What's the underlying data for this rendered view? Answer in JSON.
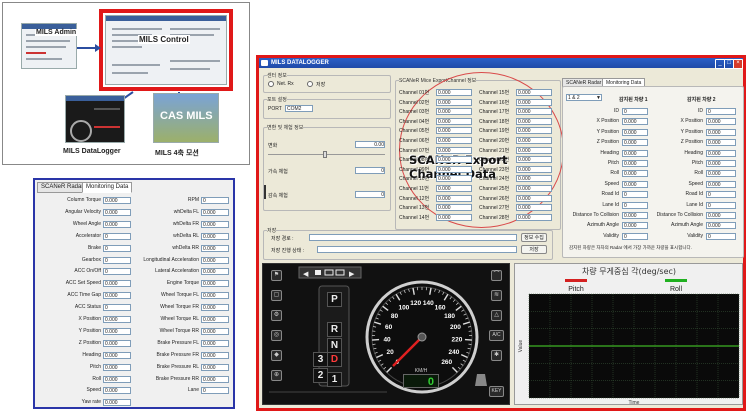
{
  "overview": {
    "admin_label": "MILS Admin",
    "control_label": "MILS  Control",
    "datalogger_label": "MILS DataLogger",
    "sim_label": "MILS 4축 모션",
    "sim_banner": "CAS MILS"
  },
  "radar_panel": {
    "tabs": [
      "SCANeR Radar",
      "Monitoring Data"
    ],
    "left_fields": [
      {
        "label": "Column Torque",
        "value": "0.000"
      },
      {
        "label": "Angular Velocity",
        "value": "0.000"
      },
      {
        "label": "Wheel Angle",
        "value": "0.000"
      },
      {
        "label": "Accelerator",
        "value": "0"
      },
      {
        "label": "Brake",
        "value": "0"
      },
      {
        "label": "Gearbox",
        "value": "0"
      },
      {
        "label": "ACC On/Off",
        "value": "0"
      },
      {
        "label": "ACC Set Speed",
        "value": "0.000"
      },
      {
        "label": "ACC Time Gap",
        "value": "0.000"
      },
      {
        "label": "ACC Status",
        "value": "0"
      },
      {
        "label": "X Position",
        "value": "0.000"
      },
      {
        "label": "Y Position",
        "value": "0.000"
      },
      {
        "label": "Z Position",
        "value": "0.000"
      },
      {
        "label": "Heading",
        "value": "0.000"
      },
      {
        "label": "Pitch",
        "value": "0.000"
      },
      {
        "label": "Roll",
        "value": "0.000"
      },
      {
        "label": "Speed",
        "value": "0.000"
      },
      {
        "label": "Yaw rate",
        "value": "0.000"
      }
    ],
    "right_fields": [
      {
        "label": "RPM",
        "value": "0"
      },
      {
        "label": "whDelta FL",
        "value": "0.000"
      },
      {
        "label": "whDelta FR",
        "value": "0.000"
      },
      {
        "label": "whDelta RL",
        "value": "0.000"
      },
      {
        "label": "whDelta RR",
        "value": "0.000"
      },
      {
        "label": "Longitudinal Acceleration",
        "value": "0.000"
      },
      {
        "label": "Lateral Acceleration",
        "value": "0.000"
      },
      {
        "label": "Engine Torque",
        "value": "0.000"
      },
      {
        "label": "Wheel Torque FL",
        "value": "0.000"
      },
      {
        "label": "Wheel Torque FR",
        "value": "0.000"
      },
      {
        "label": "Wheel Torque RL",
        "value": "0.000"
      },
      {
        "label": "Wheel Torque RR",
        "value": "0.000"
      },
      {
        "label": "Brake Pressure FL",
        "value": "0.000"
      },
      {
        "label": "Brake Pressure FR",
        "value": "0.000"
      },
      {
        "label": "Brake Pressure RL",
        "value": "0.000"
      },
      {
        "label": "Brake Pressure RR",
        "value": "0.000"
      },
      {
        "label": "Lane",
        "value": "0"
      }
    ]
  },
  "window": {
    "title": "MILS DATALOGGER",
    "conn_group": "센터 정보",
    "net_rx": "Net. Rx",
    "save_chk": "저장",
    "port_group": "포트 설정",
    "port_label": "PORT",
    "port_value": "COM2",
    "slider_group": "변환 및 체험 정보",
    "slider1_label": "변화",
    "slider1_value": "0.00",
    "slider2_label": "가속 체험",
    "slider2_value": "0",
    "slider3_label": "감속 체험",
    "slider3_value": "0",
    "save_group": "저장",
    "save_path_label": "저장 경로 :",
    "save_path_value": "",
    "save_status_label": "저장 진행 상태 :",
    "info_btn": "정보 수집",
    "save_btn": "저장",
    "export_group": "SCANeR Mice ExportChannel 정보",
    "export_note": [
      "SCANeR Export",
      "Channel Data"
    ],
    "channels_left": [
      "Channel 01번",
      "Channel 02번",
      "Channel 03번",
      "Channel 04번",
      "Channel 05번",
      "Channel 06번",
      "Channel 07번",
      "Channel 08번",
      "Channel 09번",
      "Channel 10번",
      "Channel 11번",
      "Channel 12번",
      "Channel 13번",
      "Channel 14번"
    ],
    "channels_right": [
      "Channel 15번",
      "Channel 16번",
      "Channel 17번",
      "Channel 18번",
      "Channel 19번",
      "Channel 20번",
      "Channel 21번",
      "Channel 22번",
      "Channel 23번",
      "Channel 24번",
      "Channel 25번",
      "Channel 26번",
      "Channel 27번",
      "Channel 28번"
    ],
    "channel_value": "0.000",
    "radar_tabs": [
      "SCANeR Radar",
      "Monitoring Data"
    ],
    "radar_select": "1 & 2",
    "target1": "감지된 차량 1",
    "target2": "감지된 차량 2",
    "radar_rows": [
      "ID",
      "X Position",
      "Y Position",
      "Z Position",
      "Heading",
      "Pitch",
      "Roll",
      "Speed",
      "Road Id",
      "Lane Id",
      "Distance To Collision",
      "Azimuth Angle",
      "Validity"
    ],
    "radar_values1": [
      "0",
      "0.000",
      "0.000",
      "0.000",
      "0.000",
      "0.000",
      "0.000",
      "0.000",
      "0",
      "0",
      "0.000",
      "0.000",
      "0"
    ],
    "radar_values2": [
      "0",
      "0.000",
      "0.000",
      "0.000",
      "0.000",
      "0.000",
      "0.000",
      "0.000",
      "0",
      "0",
      "0.000",
      "0.000",
      "0"
    ],
    "radar_footer": "감지된 차량은 자차의 Radar 에서 가장 가까운 차량을 표시합니다."
  },
  "dashboard": {
    "gauge_ticks": [
      "0",
      "20",
      "40",
      "60",
      "80",
      "100",
      "120",
      "140",
      "160",
      "180",
      "200",
      "220",
      "240",
      "260"
    ],
    "unit": "KM/H",
    "speed_value": "0",
    "gears": [
      "P",
      "R",
      "N",
      "D",
      "3",
      "2",
      "1"
    ],
    "active_gear": "D",
    "icon_ac": "A/C",
    "icon_key": "KEY"
  },
  "chart_panel": {
    "title": "차량 무게중심 각(deg/sec)",
    "ylabel": "Value",
    "xlabel": "Time"
  },
  "chart_data": {
    "type": "line",
    "title": "차량 무게중심 각(deg/sec)",
    "xlabel": "Time",
    "ylabel": "Value",
    "x": [
      0,
      1,
      2,
      3,
      4,
      5,
      6,
      7,
      8,
      9,
      10,
      11,
      12,
      13
    ],
    "series": [
      {
        "name": "Pitch",
        "color": "#d42020",
        "values": [
          0,
          0,
          0,
          0,
          0,
          0,
          0,
          0,
          0,
          0,
          0,
          0,
          0,
          0
        ]
      },
      {
        "name": "Roll",
        "color": "#20b020",
        "values": [
          0,
          0,
          0,
          0,
          0,
          0,
          0,
          0,
          0,
          0,
          0,
          0,
          0,
          0
        ]
      }
    ],
    "ylim": [
      -1,
      1
    ],
    "grid": true,
    "legend": "top"
  },
  "colors": {
    "highlight": "#e01818",
    "panel_border": "#2a35a8",
    "title_bar": "#2b5fc7"
  }
}
